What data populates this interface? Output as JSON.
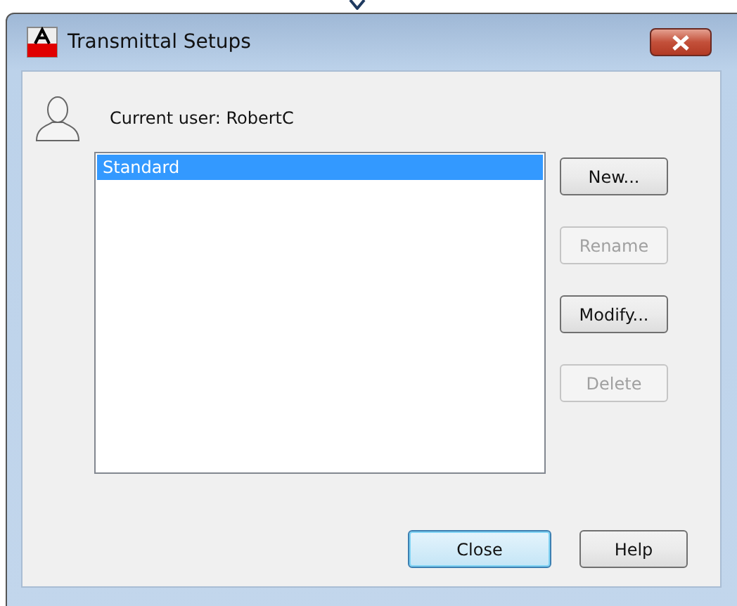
{
  "window": {
    "title": "Transmittal Setups"
  },
  "current_user": "Current user: RobertC",
  "setups": [
    {
      "label": "Standard",
      "selected": true
    }
  ],
  "side_buttons": [
    {
      "label": "New...",
      "disabled": false
    },
    {
      "label": "Rename",
      "disabled": true
    },
    {
      "label": "Modify...",
      "disabled": false
    },
    {
      "label": "Delete",
      "disabled": true
    }
  ],
  "bottom_buttons": [
    {
      "label": "Close",
      "default": true
    },
    {
      "label": "Help",
      "default": false
    }
  ]
}
